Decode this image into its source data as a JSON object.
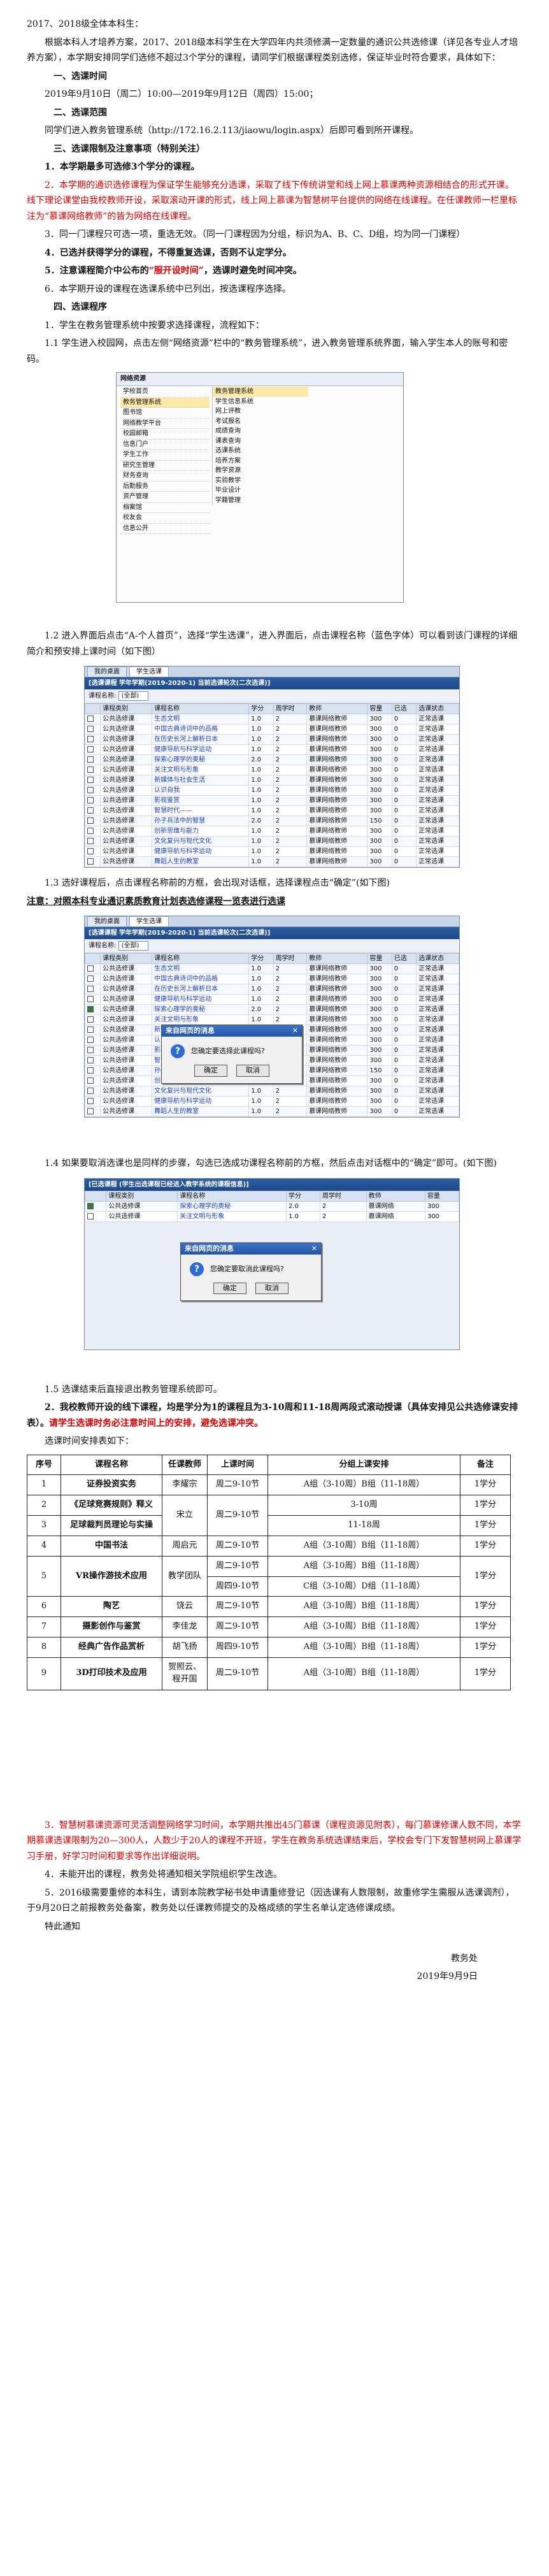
{
  "header_line": "2017、2018级全体本科生：",
  "intro": "根据本科人才培养方案，2017、2018级本科学生在大学四年内共须修满一定数量的通识公共选修课（详见各专业人才培养方案），本学期安排同学们选修不超过3个学分的课程，请同学们根据课程类别选修，保证毕业时符合要求，具体如下：",
  "sec1_title": "一、选课时间",
  "sec1_text": "2019年9月10日（周二）10:00—2019年9月12日（周四）15:00；",
  "sec2_title": "二、选课范围",
  "sec2_text": "同学们进入教务管理系统（http://172.16.2.113/jiaowu/login.aspx）后即可看到所开课程。",
  "sec3_title": "三、选课限制及注意事项（特别关注）",
  "rule1": "1．本学期最多可选修3个学分的课程。",
  "rule2": "2．本学期的通识选修课程为保证学生能够充分选课，采取了线下传统讲堂和线上网上慕课两种资源相结合的形式开课。线下理论课堂由我校教师开设，采取滚动开课的形式，线上网上慕课为智慧树平台提供的网络在线课程。在任课教师一栏里标注为“慕课网络教师”的皆为网络在线课程。",
  "rule3": "3．同一门课程只可选一项，重选无效。（同一门课程因为分组，标识为A、B、C、D组，均为同一门课程）",
  "rule4": "4．已选并获得学分的课程，不得重复选课，否则不认定学分。",
  "rule5_a": "5．注意课程简介中公布的",
  "rule5_b": "“服开设时间”",
  "rule5_c": "，选课时避免时间冲突。",
  "rule6": "6．本学期开设的课程在选课系统中已列出，按选课程序选择。",
  "sec4_title": "四、选课程序",
  "proc1": "1．学生在教务管理系统中按要求选择课程，流程如下：",
  "proc1_1": "1.1 学生进入校园网，点击左侧“网络资源”栏中的“教务管理系统”，进入教务管理系统界面，输入学生本人的账号和密码。",
  "menu_shot": {
    "head": "网络资源",
    "left": [
      "学校首页",
      "教务管理系统",
      "图书馆",
      "网络教学平台",
      "校园邮箱",
      "信息门户",
      "学生工作",
      "研究生管理",
      "财务查询",
      "后勤服务",
      "资产管理",
      "档案馆",
      "校友会",
      "信息公开"
    ],
    "right": [
      "教务管理系统",
      "学生信息系统",
      "网上评教",
      "考试报名",
      "成绩查询",
      "课表查询",
      "选课系统",
      "培养方案",
      "教学资源",
      "实验教学",
      "毕业设计",
      "学籍管理"
    ]
  },
  "proc1_2": "1.2 进入界面后点击“A-个人首页”，选择“学生选课”，进入界面后，点击课程名称（蓝色字体）可以看到该门课程的详细简介和预安排上课时间（如下图）",
  "shot_common": {
    "tab_back": "我的桌面",
    "tab_active": "学生选课",
    "strip": "[选课课程 学年学期(2019-2020-1) 当前选课轮次(二次选课)]",
    "filter_label": "课程名称:",
    "filter_value": "(全部)",
    "headers": [
      "",
      "课程类别",
      "课程名称",
      "学分",
      "周学时",
      "教师",
      "容量",
      "已选",
      "选课状态"
    ],
    "rows": [
      [
        "公共选修课",
        "生态文明",
        "1.0",
        "2",
        "慕课网络教师",
        "300",
        "0",
        "正常选课"
      ],
      [
        "公共选修课",
        "中国古典诗词中的品格",
        "1.0",
        "2",
        "慕课网络教师",
        "300",
        "0",
        "正常选课"
      ],
      [
        "公共选修课",
        "在历史长河上解析日本",
        "1.0",
        "2",
        "慕课网络教师",
        "300",
        "0",
        "正常选课"
      ],
      [
        "公共选修课",
        "健康导航与科学运动",
        "1.0",
        "2",
        "慕课网络教师",
        "300",
        "0",
        "正常选课"
      ],
      [
        "公共选修课",
        "探索心理学的奥秘",
        "2.0",
        "2",
        "慕课网络教师",
        "300",
        "0",
        "正常选课"
      ],
      [
        "公共选修课",
        "关注文明与形象",
        "1.0",
        "2",
        "慕课网络教师",
        "300",
        "0",
        "正常选课"
      ],
      [
        "公共选修课",
        "新媒体与社会生活",
        "1.0",
        "2",
        "慕课网络教师",
        "300",
        "0",
        "正常选课"
      ],
      [
        "公共选修课",
        "认识自我",
        "1.0",
        "2",
        "慕课网络教师",
        "300",
        "0",
        "正常选课"
      ],
      [
        "公共选修课",
        "影视鉴赏",
        "1.0",
        "2",
        "慕课网络教师",
        "300",
        "0",
        "正常选课"
      ],
      [
        "公共选修课",
        "智慧时代——",
        "1.0",
        "2",
        "慕课网络教师",
        "300",
        "0",
        "正常选课"
      ],
      [
        "公共选修课",
        "孙子兵法中的智慧",
        "2.0",
        "2",
        "慕课网络教师",
        "150",
        "0",
        "正常选课"
      ],
      [
        "公共选修课",
        "创新思维与能力",
        "1.0",
        "2",
        "慕课网络教师",
        "300",
        "0",
        "正常选课"
      ],
      [
        "公共选修课",
        "文化复兴与现代文化",
        "1.0",
        "2",
        "慕课网络教师",
        "300",
        "0",
        "正常选课"
      ],
      [
        "公共选修课",
        "健康导航与科学运动",
        "1.0",
        "2",
        "慕课网络教师",
        "300",
        "0",
        "正常选课"
      ],
      [
        "公共选修课",
        "舞蹈人生的教室",
        "1.0",
        "2",
        "慕课网络教师",
        "300",
        "0",
        "正常选课"
      ]
    ]
  },
  "proc1_3": "1.3 选好课程后，点击课程名称前的方框，会出现对话框，选择课程点击“确定”(如下图)",
  "note_title": "注意：对照本科专业通识素质教育计划表选修课程一览表进行选课",
  "dialog": {
    "title": "来自网页的消息",
    "close": "✕",
    "text": "您确定要选择此课程吗?",
    "ok": "确定",
    "cancel": "取消"
  },
  "proc1_4": "1.4 如果要取消选课也是同样的步骤，勾选已选成功课程名称前的方框，然后点击对话框中的“确定”即可。(如下图)",
  "shot3": {
    "strip": "[已选课程 (学生出选课程已经进入教学系统的课程信息)]",
    "headers": [
      "",
      "课程类别",
      "课程名称",
      "学分",
      "周学时",
      "教师",
      "容量"
    ],
    "rows": [
      [
        "公共选修课",
        "探索心理学的奥秘",
        "2.0",
        "2",
        "慕课网络",
        "300"
      ],
      [
        "公共选修课",
        "关注文明与形象",
        "1.0",
        "2",
        "慕课网络",
        "300"
      ]
    ],
    "dialog_text": "您确定要取消此课程吗?"
  },
  "proc1_5": "1.5 选课结束后直接退出教务管理系统即可。",
  "proc2_a": "2．我校教师开设的线下课程，均是学分为1的课程且为3-10周和11-18周两段式滚动授课（具体安排见公共选修课安排表）。",
  "proc2_b": "请学生选课时务必注意时间上的安排，避免选课冲突。",
  "proc2_c": "选课时间安排表如下：",
  "sched": {
    "headers": [
      "序号",
      "课程名称",
      "任课教师",
      "上课时间",
      "分组上课安排",
      "备注"
    ],
    "rows": [
      {
        "no": "1",
        "course": "证券投资实务",
        "teacher": "李耀宗",
        "time": "周二9-10节",
        "plan": "A组（3-10周）B组（11-18周）",
        "note": "1学分"
      },
      {
        "no": "2",
        "course": "《足球竞赛规则》释义",
        "teacher": "宋立",
        "time": "周二9-10节",
        "plan": "3-10周",
        "note": "1学分"
      },
      {
        "no": "3",
        "course": "足球裁判员理论与实操",
        "teacher": "",
        "time": "",
        "plan": "11-18周",
        "note": "1学分"
      },
      {
        "no": "4",
        "course": "中国书法",
        "teacher": "周启元",
        "time": "周二9-10节",
        "plan": "A组（3-10周）B组（11-18周）",
        "note": "1学分"
      },
      {
        "no": "5",
        "course": "VR操作游技术应用",
        "teacher": "教学团队",
        "time": "周二9-10节",
        "plan": "A组（3-10周）B组（11-18周）",
        "note": "1学分"
      },
      {
        "no": "",
        "course": "",
        "teacher": "",
        "time": "周四9-10节",
        "plan": "C组（3-10周）D组（11-18周）",
        "note": ""
      },
      {
        "no": "6",
        "course": "陶艺",
        "teacher": "饶云",
        "time": "周二9-10节",
        "plan": "A组（3-10周）B组（11-18周）",
        "note": "1学分"
      },
      {
        "no": "7",
        "course": "摄影创作与鉴赏",
        "teacher": "李佳龙",
        "time": "周二9-10节",
        "plan": "A组（3-10周）B组（11-18周）",
        "note": "1学分"
      },
      {
        "no": "8",
        "course": "经典广告作品赏析",
        "teacher": "胡飞扬",
        "time": "周四9-10节",
        "plan": "A组（3-10周）B组（11-18周）",
        "note": "1学分"
      },
      {
        "no": "9",
        "course": "3D打印技术及应用",
        "teacher": "贺照云、程开国",
        "time": "周二9-10节",
        "plan": "A组（3-10周）B组（11-18周）",
        "note": "1学分"
      }
    ]
  },
  "proc3": "3．智慧树慕课资源可灵活调整网络学习时间，本学期共推出45门慕课（课程资源见附表），每门慕课修课人数不同，本学期慕课选课限制为20—300人，人数少于20人的课程不开班，学生在教务系统选课结束后，学校会专门下发智慧树网上慕课学习手册，好学习时间和要求等作出详细说明。",
  "proc4": "4．未能开出的课程，教务处将通知相关学院组织学生改选。",
  "proc5": "5．2016级需要重修的本科生，请到本院教学秘书处申请重修登记（因选课有人数限制，故重修学生需服从选课调剂），于9月20日之前报教务处备案，教务处以任课教师提交的及格成绩的学生名单认定选修课成绩。",
  "closing": "特此通知",
  "signer": "教务处",
  "sign_date": "2019年9月9日"
}
